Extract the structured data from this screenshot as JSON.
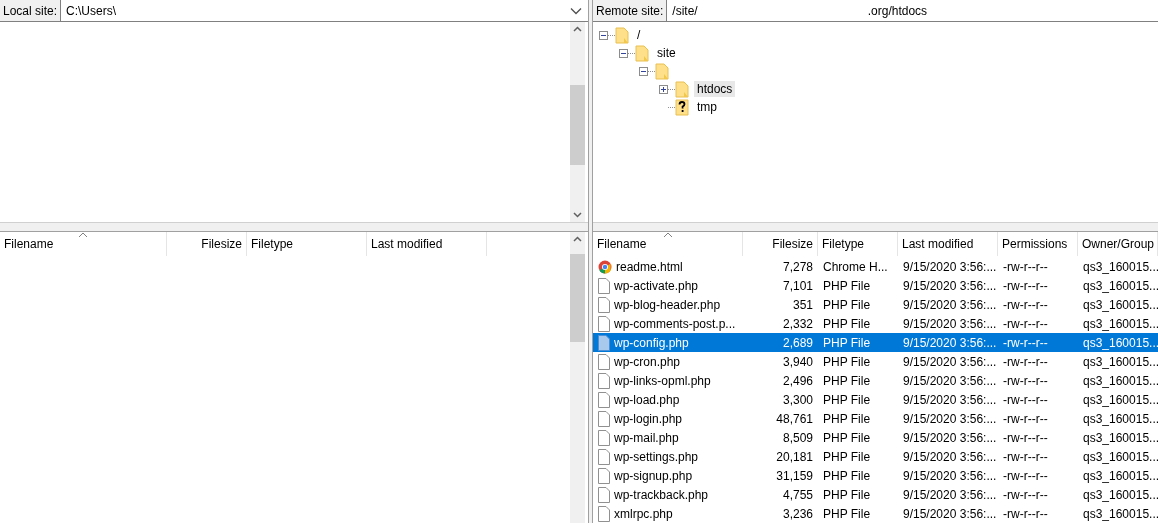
{
  "local": {
    "label": "Local site:",
    "path": "C:\\Users\\",
    "columns": [
      {
        "label": "Filename",
        "sorted": true
      },
      {
        "label": "Filesize",
        "sorted": false
      },
      {
        "label": "Filetype",
        "sorted": false
      },
      {
        "label": "Last modified",
        "sorted": false
      }
    ]
  },
  "remote": {
    "label": "Remote site:",
    "path": "/site/                                                   .org/htdocs",
    "tree": [
      {
        "name": "/",
        "kind": "folder",
        "expanded": true,
        "selected": false,
        "children": [
          {
            "name": "site",
            "kind": "folder",
            "expanded": true,
            "selected": false,
            "children": [
              {
                "kind": "folder",
                "expanded": true,
                "children": [
                  {
                    "name": "htdocs",
                    "kind": "folder",
                    "expanded": false,
                    "selected": true
                  },
                  {
                    "name": "tmp",
                    "kind": "unknown",
                    "selected": false
                  }
                ]
              }
            ]
          }
        ]
      }
    ],
    "columns": [
      {
        "label": "Filename",
        "sorted": true
      },
      {
        "label": "Filesize",
        "sorted": false
      },
      {
        "label": "Filetype",
        "sorted": false
      },
      {
        "label": "Last modified",
        "sorted": false
      },
      {
        "label": "Permissions",
        "sorted": false
      },
      {
        "label": "Owner/Group",
        "sorted": false
      }
    ],
    "files": [
      {
        "name": "readme.html",
        "kind": "chrome",
        "size": "7,278",
        "type": "Chrome H...",
        "modified": "9/15/2020 3:56:...",
        "permissions": "-rw-r--r--",
        "owner": "qs3_160015...",
        "selected": false
      },
      {
        "name": "wp-activate.php",
        "kind": "file",
        "size": "7,101",
        "type": "PHP File",
        "modified": "9/15/2020 3:56:...",
        "permissions": "-rw-r--r--",
        "owner": "qs3_160015...",
        "selected": false
      },
      {
        "name": "wp-blog-header.php",
        "kind": "file",
        "size": "351",
        "type": "PHP File",
        "modified": "9/15/2020 3:56:...",
        "permissions": "-rw-r--r--",
        "owner": "qs3_160015...",
        "selected": false
      },
      {
        "name": "wp-comments-post.p...",
        "kind": "file",
        "size": "2,332",
        "type": "PHP File",
        "modified": "9/15/2020 3:56:...",
        "permissions": "-rw-r--r--",
        "owner": "qs3_160015...",
        "selected": false
      },
      {
        "name": "wp-config.php",
        "kind": "file",
        "size": "2,689",
        "type": "PHP File",
        "modified": "9/15/2020 3:56:...",
        "permissions": "-rw-r--r--",
        "owner": "qs3_160015...",
        "selected": true
      },
      {
        "name": "wp-cron.php",
        "kind": "file",
        "size": "3,940",
        "type": "PHP File",
        "modified": "9/15/2020 3:56:...",
        "permissions": "-rw-r--r--",
        "owner": "qs3_160015...",
        "selected": false
      },
      {
        "name": "wp-links-opml.php",
        "kind": "file",
        "size": "2,496",
        "type": "PHP File",
        "modified": "9/15/2020 3:56:...",
        "permissions": "-rw-r--r--",
        "owner": "qs3_160015...",
        "selected": false
      },
      {
        "name": "wp-load.php",
        "kind": "file",
        "size": "3,300",
        "type": "PHP File",
        "modified": "9/15/2020 3:56:...",
        "permissions": "-rw-r--r--",
        "owner": "qs3_160015...",
        "selected": false
      },
      {
        "name": "wp-login.php",
        "kind": "file",
        "size": "48,761",
        "type": "PHP File",
        "modified": "9/15/2020 3:56:...",
        "permissions": "-rw-r--r--",
        "owner": "qs3_160015...",
        "selected": false
      },
      {
        "name": "wp-mail.php",
        "kind": "file",
        "size": "8,509",
        "type": "PHP File",
        "modified": "9/15/2020 3:56:...",
        "permissions": "-rw-r--r--",
        "owner": "qs3_160015...",
        "selected": false
      },
      {
        "name": "wp-settings.php",
        "kind": "file",
        "size": "20,181",
        "type": "PHP File",
        "modified": "9/15/2020 3:56:...",
        "permissions": "-rw-r--r--",
        "owner": "qs3_160015...",
        "selected": false
      },
      {
        "name": "wp-signup.php",
        "kind": "file",
        "size": "31,159",
        "type": "PHP File",
        "modified": "9/15/2020 3:56:...",
        "permissions": "-rw-r--r--",
        "owner": "qs3_160015...",
        "selected": false
      },
      {
        "name": "wp-trackback.php",
        "kind": "file",
        "size": "4,755",
        "type": "PHP File",
        "modified": "9/15/2020 3:56:...",
        "permissions": "-rw-r--r--",
        "owner": "qs3_160015...",
        "selected": false
      },
      {
        "name": "xmlrpc.php",
        "kind": "file",
        "size": "3,236",
        "type": "PHP File",
        "modified": "9/15/2020 3:56:...",
        "permissions": "-rw-r--r--",
        "owner": "qs3_160015...",
        "selected": false
      }
    ]
  }
}
